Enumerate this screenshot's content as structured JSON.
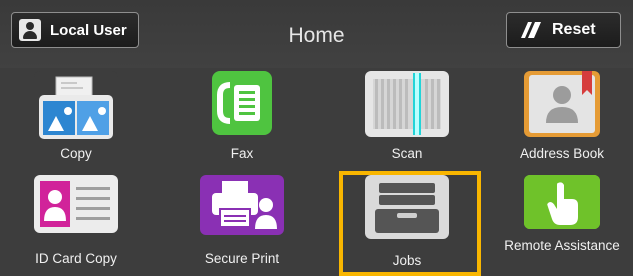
{
  "header": {
    "user_button": "Local User",
    "title": "Home",
    "reset_button": "Reset"
  },
  "tiles": [
    {
      "label": "Copy",
      "icon": "copy-icon"
    },
    {
      "label": "Fax",
      "icon": "fax-icon"
    },
    {
      "label": "Scan",
      "icon": "scan-icon"
    },
    {
      "label": "Address Book",
      "icon": "address-book-icon"
    },
    {
      "label": "ID Card Copy",
      "icon": "id-card-icon"
    },
    {
      "label": "Secure Print",
      "icon": "secure-print-icon"
    },
    {
      "label": "Jobs",
      "icon": "jobs-icon",
      "selected": true
    },
    {
      "label": "Remote Assistance",
      "icon": "remote-assistance-icon"
    }
  ],
  "colors": {
    "background": "#3d3d3d",
    "selection": "#f9b600",
    "fax": "#4fc440",
    "secure_print": "#8a30b4",
    "remote_assistance": "#7fce35"
  }
}
